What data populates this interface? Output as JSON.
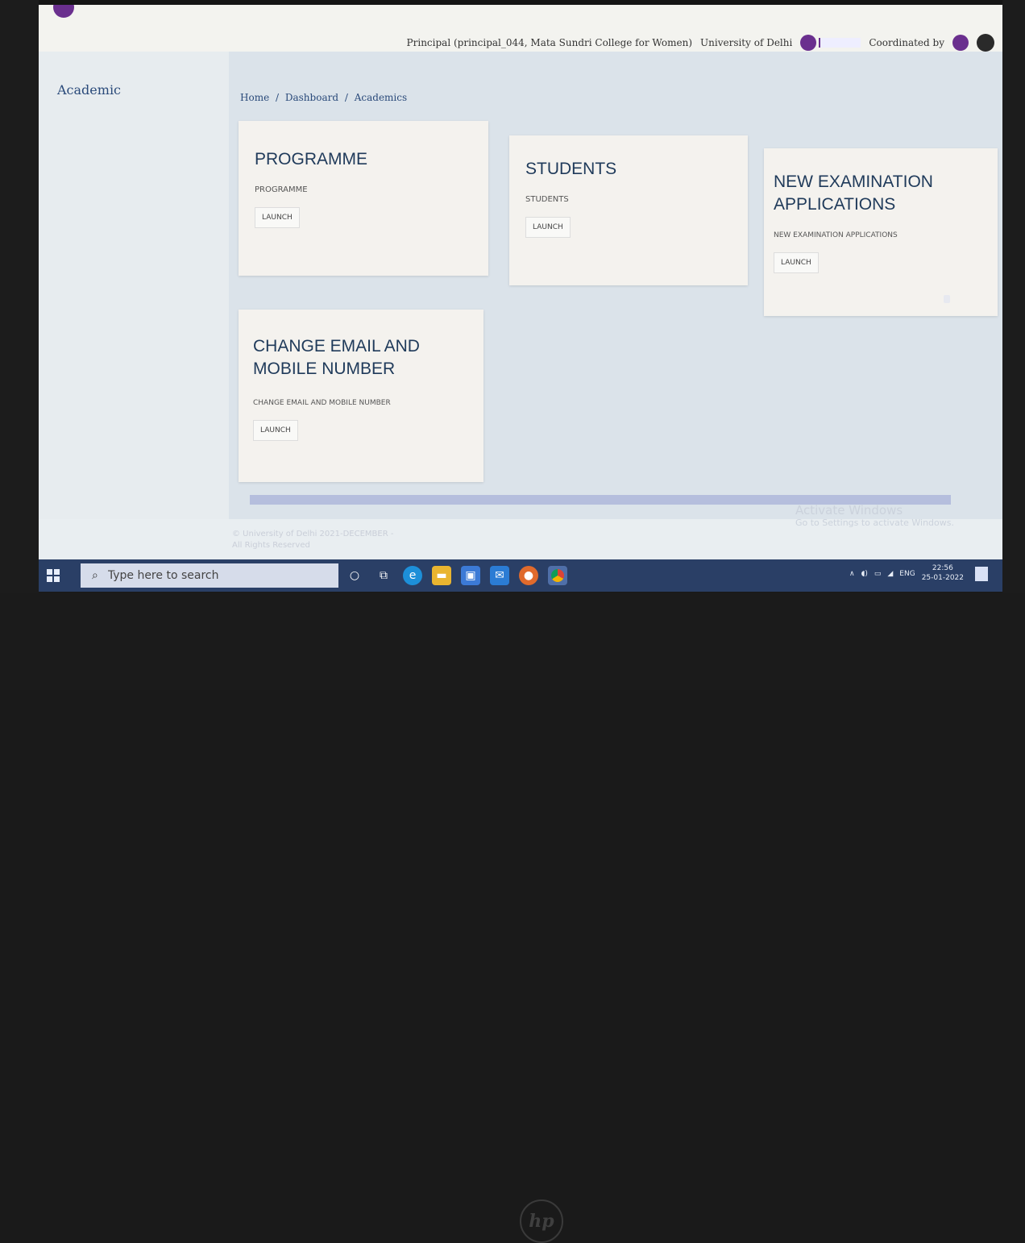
{
  "header": {
    "principal": "Principal (principal_044, Mata Sundri College for Women)",
    "university": "University of Delhi",
    "coordinated_by": "Coordinated by"
  },
  "sidebar": {
    "title": "Academic"
  },
  "breadcrumb": {
    "home": "Home",
    "dashboard": "Dashboard",
    "academics": "Academics",
    "sep": "/"
  },
  "cards": [
    {
      "title": "PROGRAMME",
      "subtitle": "PROGRAMME",
      "button": "LAUNCH"
    },
    {
      "title": "STUDENTS",
      "subtitle": "STUDENTS",
      "button": "LAUNCH"
    },
    {
      "title": "NEW EXAMINATION APPLICATIONS",
      "subtitle": "NEW EXAMINATION APPLICATIONS",
      "button": "LAUNCH"
    },
    {
      "title": "CHANGE EMAIL AND MOBILE NUMBER",
      "subtitle": "CHANGE EMAIL AND MOBILE NUMBER",
      "button": "LAUNCH"
    }
  ],
  "footer": {
    "line1": "© University of Delhi 2021-DECEMBER -",
    "line2": "All Rights Reserved"
  },
  "watermark": {
    "line1": "Activate Windows",
    "line2": "Go to Settings to activate Windows."
  },
  "taskbar": {
    "search_placeholder": "Type here to search",
    "language": "ENG",
    "time": "22:56",
    "date": "25-01-2022"
  },
  "device": {
    "logo": "hp"
  },
  "colors": {
    "taskbar": "#2a3f66",
    "heading": "#1f3a5a",
    "link": "#2a4a7a"
  }
}
